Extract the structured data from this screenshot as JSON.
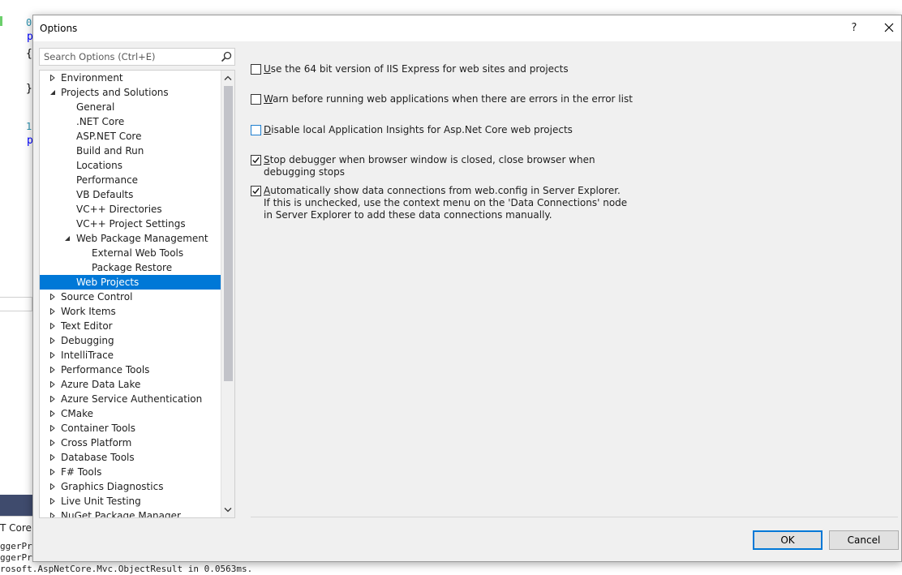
{
  "background": {
    "line_numbers": [
      "0",
      "1"
    ],
    "code_fragments": [
      "p",
      "{",
      "}",
      "p",
      "p"
    ],
    "output_tab_label": "T Core W",
    "output_lines": [
      "ggerPr",
      "ggerPr",
      "rosoft.AspNetCore.Mvc.ObjectResult in 0.0563ms."
    ]
  },
  "dialog": {
    "title": "Options",
    "help_label": "?",
    "search": {
      "placeholder": "Search Options (Ctrl+E)",
      "value": ""
    },
    "tree": [
      {
        "label": "Environment",
        "level": 0,
        "state": "collapsed"
      },
      {
        "label": "Projects and Solutions",
        "level": 0,
        "state": "expanded"
      },
      {
        "label": "General",
        "level": 1,
        "state": "leaf"
      },
      {
        "label": ".NET Core",
        "level": 1,
        "state": "leaf"
      },
      {
        "label": "ASP.NET Core",
        "level": 1,
        "state": "leaf"
      },
      {
        "label": "Build and Run",
        "level": 1,
        "state": "leaf"
      },
      {
        "label": "Locations",
        "level": 1,
        "state": "leaf"
      },
      {
        "label": "Performance",
        "level": 1,
        "state": "leaf"
      },
      {
        "label": "VB Defaults",
        "level": 1,
        "state": "leaf"
      },
      {
        "label": "VC++ Directories",
        "level": 1,
        "state": "leaf"
      },
      {
        "label": "VC++ Project Settings",
        "level": 1,
        "state": "leaf"
      },
      {
        "label": "Web Package Management",
        "level": 1,
        "state": "expanded"
      },
      {
        "label": "External Web Tools",
        "level": 2,
        "state": "leaf"
      },
      {
        "label": "Package Restore",
        "level": 2,
        "state": "leaf"
      },
      {
        "label": "Web Projects",
        "level": 1,
        "state": "leaf",
        "selected": true
      },
      {
        "label": "Source Control",
        "level": 0,
        "state": "collapsed"
      },
      {
        "label": "Work Items",
        "level": 0,
        "state": "collapsed"
      },
      {
        "label": "Text Editor",
        "level": 0,
        "state": "collapsed"
      },
      {
        "label": "Debugging",
        "level": 0,
        "state": "collapsed"
      },
      {
        "label": "IntelliTrace",
        "level": 0,
        "state": "collapsed"
      },
      {
        "label": "Performance Tools",
        "level": 0,
        "state": "collapsed"
      },
      {
        "label": "Azure Data Lake",
        "level": 0,
        "state": "collapsed"
      },
      {
        "label": "Azure Service Authentication",
        "level": 0,
        "state": "collapsed"
      },
      {
        "label": "CMake",
        "level": 0,
        "state": "collapsed"
      },
      {
        "label": "Container Tools",
        "level": 0,
        "state": "collapsed"
      },
      {
        "label": "Cross Platform",
        "level": 0,
        "state": "collapsed"
      },
      {
        "label": "Database Tools",
        "level": 0,
        "state": "collapsed"
      },
      {
        "label": "F# Tools",
        "level": 0,
        "state": "collapsed"
      },
      {
        "label": "Graphics Diagnostics",
        "level": 0,
        "state": "collapsed"
      },
      {
        "label": "Live Unit Testing",
        "level": 0,
        "state": "collapsed"
      },
      {
        "label": "NuGet Package Manager",
        "level": 0,
        "state": "collapsed"
      }
    ],
    "options": [
      {
        "key": "use64bit",
        "label_underlined": "U",
        "label_rest": "se the 64 bit version of IIS Express for web sites and projects",
        "checked": false
      },
      {
        "key": "warnErrors",
        "label_underlined": "W",
        "label_rest": "arn before running web applications when there are errors in the error list",
        "checked": false
      },
      {
        "key": "disableInsights",
        "label_underlined": "D",
        "label_rest": "isable local Application Insights for Asp.Net Core web projects",
        "checked": false
      },
      {
        "key": "stopDebugger",
        "label_underlined": "S",
        "label_rest": "top debugger when browser window is closed, close browser when debugging stops",
        "checked": true
      },
      {
        "key": "autoDataConnections",
        "label_underlined": "A",
        "label_rest": "utomatically show data connections from web.config in Server Explorer.",
        "checked": true,
        "description": "If this is unchecked, use the context menu on the 'Data Connections' node in Server Explorer to add these data connections manually."
      }
    ],
    "buttons": {
      "ok": "OK",
      "cancel": "Cancel"
    },
    "colors": {
      "selection": "#0078d7",
      "dialog_bg": "#f0f0f0",
      "default_button_border": "#0078d7"
    }
  }
}
